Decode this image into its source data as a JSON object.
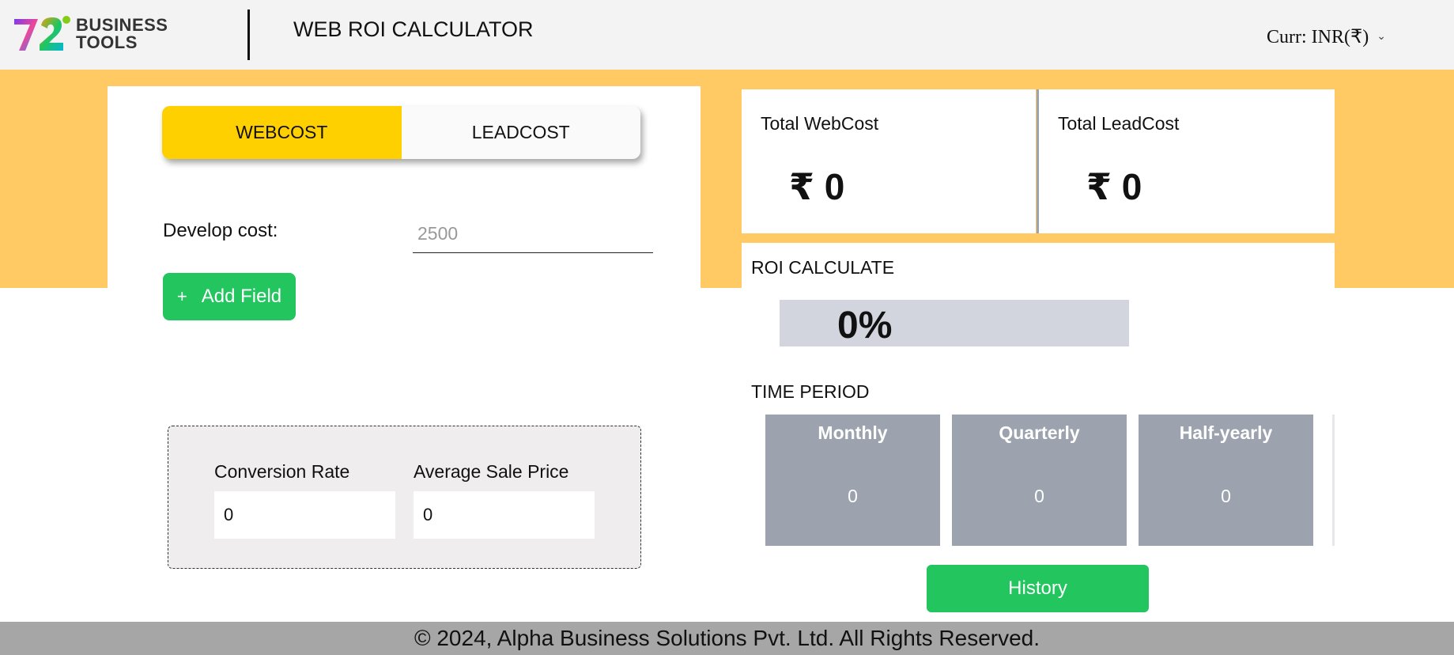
{
  "header": {
    "logo_number": "72",
    "logo_line1": "BUSINESS",
    "logo_line2": "TOOLS",
    "title": "WEB ROI CALCULATOR",
    "currency": "Curr: INR(₹)"
  },
  "tabs": [
    {
      "label": "WEBCOST",
      "active": true
    },
    {
      "label": "LEADCOST",
      "active": false
    }
  ],
  "form": {
    "develop_label": "Develop cost:",
    "develop_placeholder": "2500",
    "add_field_label": "Add Field",
    "conversion_label": "Conversion Rate",
    "conversion_value": "0",
    "avg_price_label": "Average Sale Price",
    "avg_price_value": "0"
  },
  "totals": {
    "webcost_label": "Total WebCost",
    "webcost_value": "₹ 0",
    "leadcost_label": "Total LeadCost",
    "leadcost_value": "₹ 0"
  },
  "roi": {
    "label": "ROI CALCULATE",
    "value": "0%"
  },
  "time_period": {
    "label": "TIME PERIOD",
    "periods": [
      {
        "name": "Monthly",
        "value": "0"
      },
      {
        "name": "Quarterly",
        "value": "0"
      },
      {
        "name": "Half-yearly",
        "value": "0"
      }
    ]
  },
  "history_label": "History",
  "footer": "© 2024, Alpha Business Solutions Pvt. Ltd. All Rights Reserved.",
  "colors": {
    "accent_yellow": "#ffca63",
    "active_tab": "#ffd000",
    "green_button": "#22c55e",
    "period_tile": "#9ca3af"
  }
}
